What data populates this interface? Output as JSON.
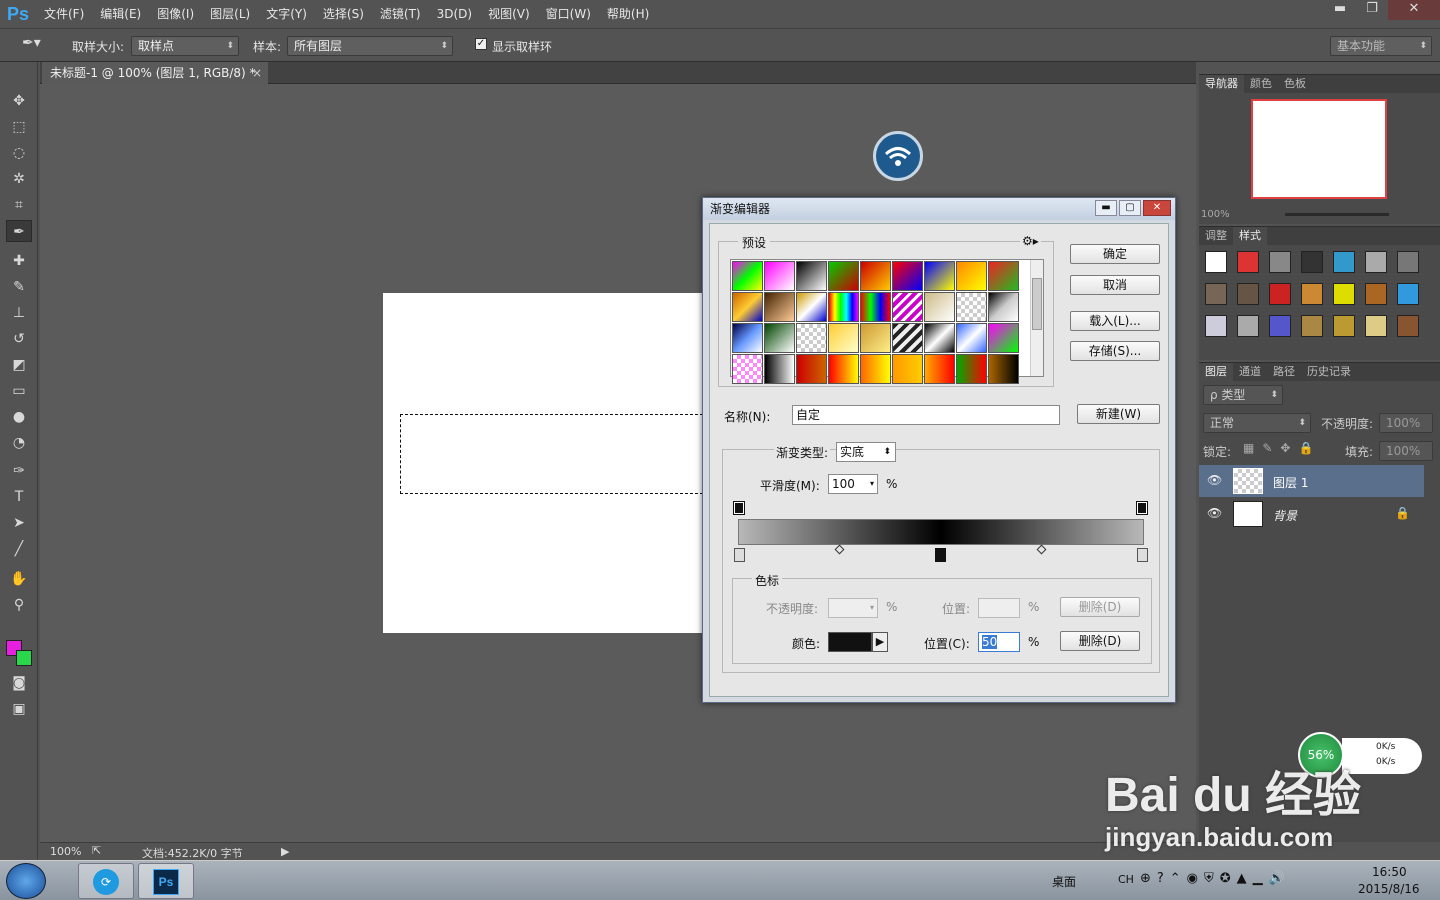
{
  "app": {
    "logo": "Ps"
  },
  "menu": [
    "文件(F)",
    "编辑(E)",
    "图像(I)",
    "图层(L)",
    "文字(Y)",
    "选择(S)",
    "滤镜(T)",
    "3D(D)",
    "视图(V)",
    "窗口(W)",
    "帮助(H)"
  ],
  "window_buttons": {
    "minimize": "▬",
    "maximize": "❐",
    "close": "✕"
  },
  "options": {
    "sample_size_label": "取样大小:",
    "sample_size_value": "取样点",
    "sample_label": "样本:",
    "sample_value": "所有图层",
    "show_ring_label": "显示取样环",
    "workspace": "基本功能"
  },
  "document": {
    "tab_title": "未标题-1 @ 100% (图层 1, RGB/8) *",
    "zoom": "100%",
    "doc_info": "文档:452.2K/0 字节"
  },
  "panels": {
    "navigator_tabs": [
      "导航器",
      "颜色",
      "色板"
    ],
    "nav_zoom": "100%",
    "adjust_tabs": [
      "调整",
      "样式"
    ],
    "layers_tabs": [
      "图层",
      "通道",
      "路径",
      "历史记录"
    ],
    "kind_filter": "ρ 类型",
    "blend_mode": "正常",
    "opacity_label": "不透明度:",
    "opacity_value": "100%",
    "lock_label": "锁定:",
    "fill_label": "填充:",
    "fill_value": "100%",
    "layers": [
      {
        "name": "图层 1",
        "selected": true
      },
      {
        "name": "背景",
        "selected": false
      }
    ]
  },
  "dialog": {
    "title": "渐变编辑器",
    "presets_label": "预设",
    "ok": "确定",
    "cancel": "取消",
    "load": "载入(L)...",
    "save": "存储(S)...",
    "name_label": "名称(N):",
    "name_value": "自定",
    "new": "新建(W)",
    "type_label": "渐变类型:",
    "type_value": "实底",
    "smooth_label": "平滑度(M):",
    "smooth_value": "100",
    "percent": "%",
    "stops_label": "色标",
    "opacity_label": "不透明度:",
    "position_label": "位置:",
    "delete": "删除(D)",
    "color_label": "颜色:",
    "position_c_label": "位置(C):",
    "position_c_value": "50",
    "color_stop_color": "#111111"
  },
  "colors": {
    "foreground": "#e81fe0",
    "background": "#28d84a",
    "accent": "#3fa9f5"
  },
  "taskbar": {
    "desktop_label": "桌面",
    "ime": "CH",
    "time": "16:50",
    "date": "2015/8/16",
    "net_percent": "56%",
    "up_speed": "0K/s",
    "down_speed": "0K/s"
  },
  "watermark": {
    "line1": "Bai du 经验",
    "line2": "jingyan.baidu.com"
  }
}
